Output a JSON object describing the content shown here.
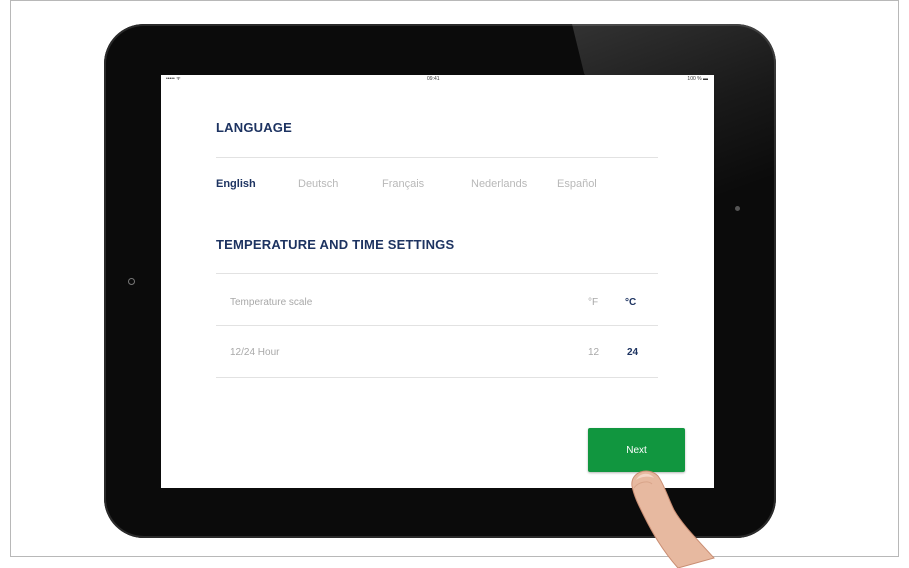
{
  "status_bar": {
    "carrier": "••••• ᯤ",
    "time": "09:41",
    "battery": "100 % ▬"
  },
  "language": {
    "title": "LANGUAGE",
    "options": [
      "English",
      "Deutsch",
      "Français",
      "Nederlands",
      "Español"
    ],
    "selected": "English"
  },
  "temp_time": {
    "title": "TEMPERATURE AND TIME SETTINGS",
    "rows": [
      {
        "label": "Temperature scale",
        "options": [
          "°F",
          "°C"
        ],
        "selected": "°C"
      },
      {
        "label": "12/24 Hour",
        "options": [
          "12",
          "24"
        ],
        "selected": "24"
      }
    ]
  },
  "next_button": {
    "label": "Next",
    "color": "#11963f"
  },
  "colors": {
    "accent": "#1d3361",
    "bezel": "#0b0b0b"
  }
}
